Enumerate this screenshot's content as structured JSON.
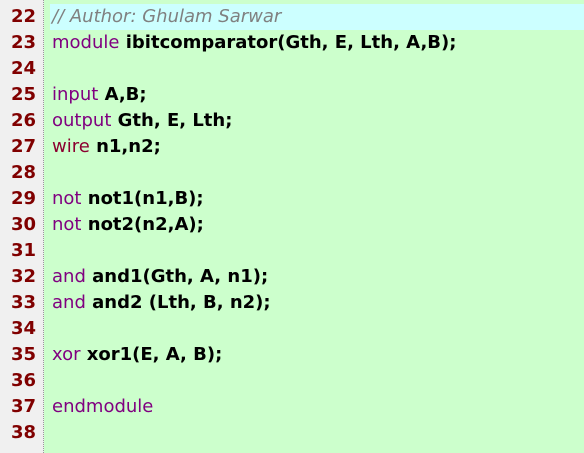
{
  "editor": {
    "lines": [
      {
        "n": "22",
        "highlight": true,
        "parts": [
          {
            "t": "// Author: Ghulam Sarwar",
            "c": "cm"
          }
        ]
      },
      {
        "n": "23",
        "parts": [
          {
            "t": "module",
            "c": "kw"
          },
          {
            "t": " ibitcomparator(Gth, E, Lth, A,B);",
            "c": "id"
          }
        ]
      },
      {
        "n": "24",
        "parts": []
      },
      {
        "n": "25",
        "parts": [
          {
            "t": "input",
            "c": "kw"
          },
          {
            "t": " A,B;",
            "c": "id"
          }
        ]
      },
      {
        "n": "26",
        "parts": [
          {
            "t": "output",
            "c": "kw"
          },
          {
            "t": " Gth, E, Lth;",
            "c": "id"
          }
        ]
      },
      {
        "n": "27",
        "parts": [
          {
            "t": "wire",
            "c": "wire"
          },
          {
            "t": " n1,n2;",
            "c": "id"
          }
        ]
      },
      {
        "n": "28",
        "parts": []
      },
      {
        "n": "29",
        "parts": [
          {
            "t": "not",
            "c": "kw"
          },
          {
            "t": " not1(n1,B);",
            "c": "id"
          }
        ]
      },
      {
        "n": "30",
        "parts": [
          {
            "t": "not",
            "c": "kw"
          },
          {
            "t": " not2(n2,A);",
            "c": "id"
          }
        ]
      },
      {
        "n": "31",
        "parts": []
      },
      {
        "n": "32",
        "parts": [
          {
            "t": "and",
            "c": "kw"
          },
          {
            "t": " and1(Gth, A, n1);",
            "c": "id"
          }
        ]
      },
      {
        "n": "33",
        "parts": [
          {
            "t": "and",
            "c": "kw"
          },
          {
            "t": " and2 (Lth, B, n2);",
            "c": "id"
          }
        ]
      },
      {
        "n": "34",
        "parts": []
      },
      {
        "n": "35",
        "parts": [
          {
            "t": "xor",
            "c": "kw"
          },
          {
            "t": " xor1(E, A, B);",
            "c": "id"
          }
        ]
      },
      {
        "n": "36",
        "parts": []
      },
      {
        "n": "37",
        "parts": [
          {
            "t": "endmodule",
            "c": "kw"
          }
        ]
      },
      {
        "n": "38",
        "parts": []
      }
    ]
  }
}
